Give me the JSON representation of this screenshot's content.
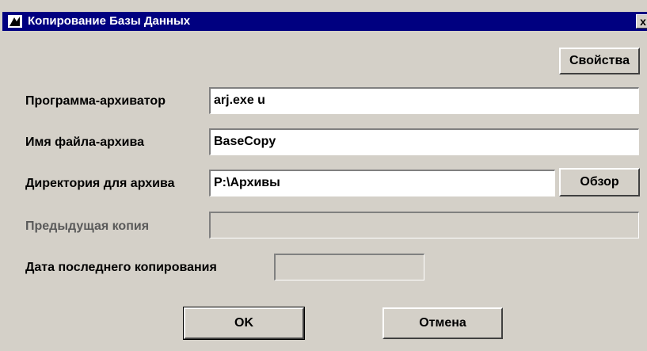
{
  "window": {
    "title": "Копирование Базы Данных",
    "close_label": "x"
  },
  "toolbar": {
    "properties_label": "Свойства"
  },
  "form": {
    "archiver_label": "Программа-архиватор",
    "archiver_value": "arj.exe u",
    "archive_name_label": "Имя файла-архива",
    "archive_name_value": "BaseCopy",
    "archive_dir_label": "Директория для архива",
    "archive_dir_value": "P:\\Архивы",
    "browse_label": "Обзор",
    "previous_copy_label": "Предыдущая копия",
    "previous_copy_value": "",
    "last_copy_date_label": "Дата последнего копирования",
    "last_copy_date_value": ""
  },
  "footer": {
    "ok_label": "OK",
    "cancel_label": "Отмена"
  }
}
